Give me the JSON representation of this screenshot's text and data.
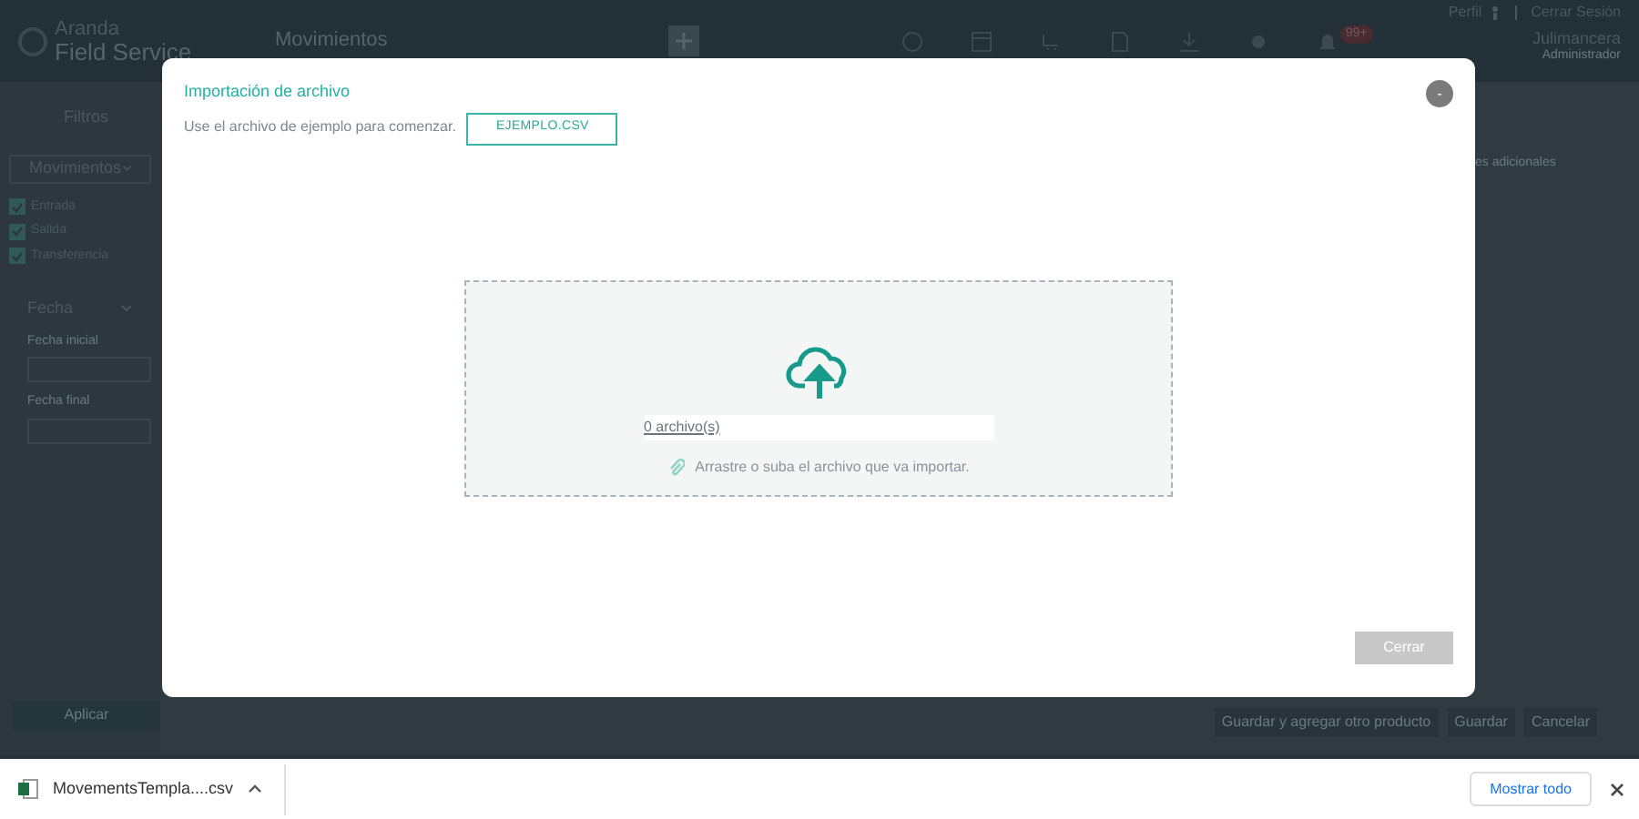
{
  "app": {
    "logo": {
      "line_1": "Aranda",
      "line_2": "Field Service"
    },
    "page_title": "Movimientos",
    "notification_badge": "99+",
    "user_links": [
      "Perfil",
      "Cerrar Sesión"
    ],
    "user_name": "Julimancera",
    "user_role": "Administrador"
  },
  "sidebar": {
    "title": "Filtros",
    "dropdown": "Movimientos",
    "checkboxes": [
      {
        "label": "Entrada",
        "checked": true
      },
      {
        "label": "Salida",
        "checked": true
      },
      {
        "label": "Transferencia",
        "checked": true
      }
    ],
    "section": "Fecha",
    "fields": [
      "Fecha inicial",
      "Fecha final"
    ],
    "apply_button": "Aplicar"
  },
  "right_panel": {
    "label": "es adicionales"
  },
  "footer_buttons": [
    "Guardar y agregar otro producto",
    "Guardar",
    "Cancelar"
  ],
  "modal": {
    "title": "Importación de archivo",
    "subtitle": "Use el archivo de ejemplo para comenzar.",
    "sample_button": "EJEMPLO.CSV",
    "close_icon": "-",
    "file_count": "0 archivo(s)",
    "hint": "Arrastre o suba el archivo que va importar.",
    "close_button": "Cerrar"
  },
  "download_bar": {
    "file": "MovementsTempla....csv",
    "show_all": "Mostrar todo"
  }
}
